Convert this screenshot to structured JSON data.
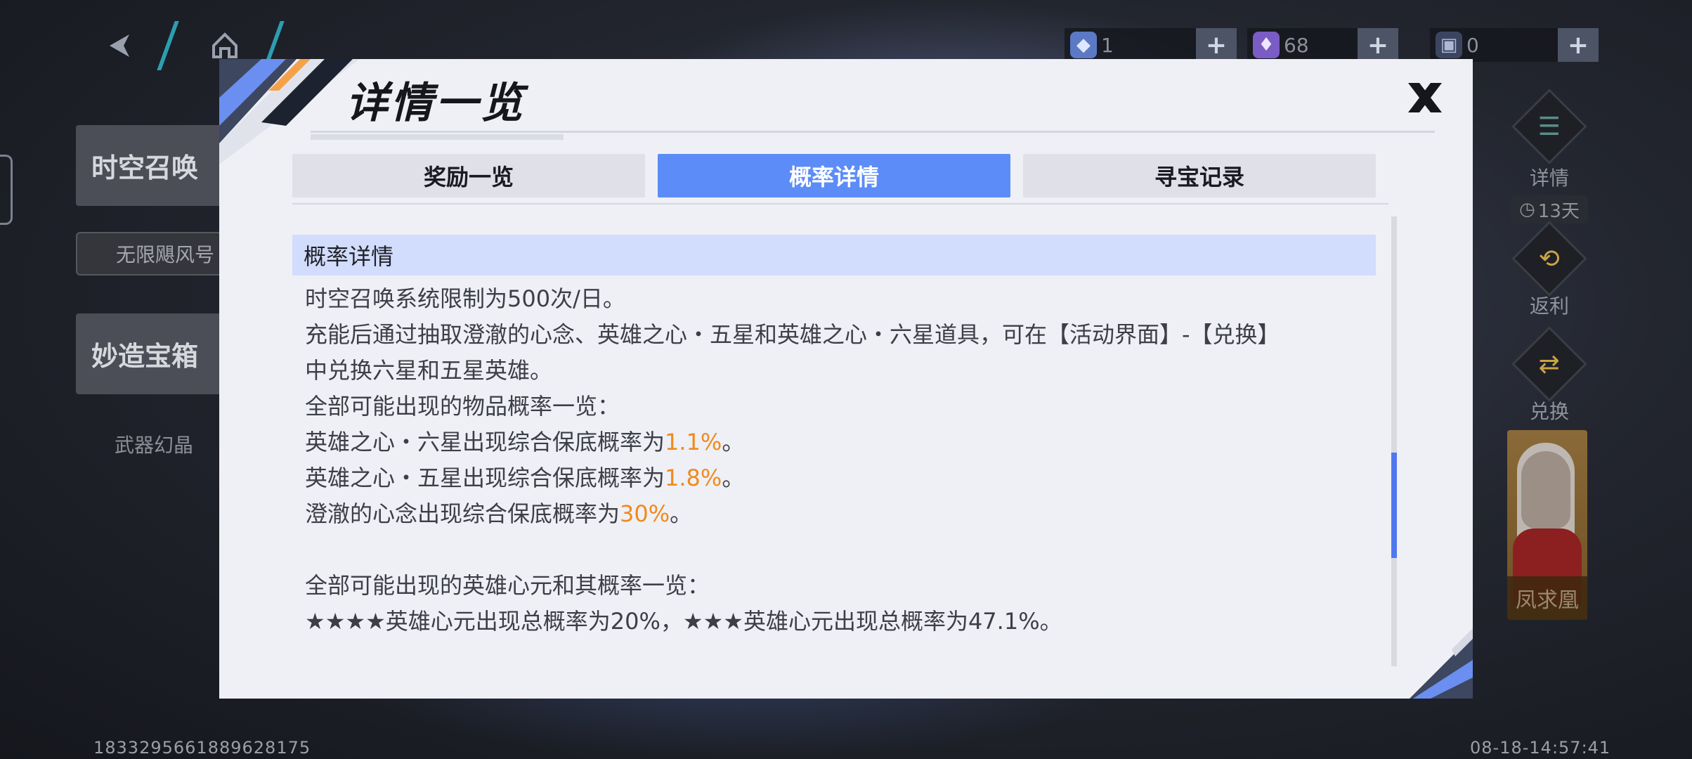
{
  "background": {
    "side_menu": {
      "item1": "时空召唤",
      "item1_sub": "无限飓风号",
      "item2": "妙造宝箱",
      "item2_sub": "武器幻晶"
    },
    "currencies": [
      {
        "icon": "crystal-icon",
        "value": "1"
      },
      {
        "icon": "gem-icon",
        "value": "68"
      },
      {
        "icon": "ticket-icon",
        "value": "0"
      }
    ],
    "right_panel": {
      "details_label": "详情",
      "timer_label": "13天",
      "rebate_label": "返利",
      "exchange_label": "兑换",
      "hero_name": "凤求凰"
    },
    "footer_id": "1833295661889628175",
    "footer_time": "08-18-14:57:41"
  },
  "dialog": {
    "title": "详情一览",
    "close_glyph": "✕",
    "tabs": [
      {
        "label": "奖励一览",
        "active": false
      },
      {
        "label": "概率详情",
        "active": true
      },
      {
        "label": "寻宝记录",
        "active": false
      }
    ],
    "section_title": "概率详情",
    "lines": {
      "l1": "时空召唤系统限制为500次/日。",
      "l2": "充能后通过抽取澄澈的心念、英雄之心・五星和英雄之心・六星道具，可在【活动界面】-【兑换】",
      "l3": "中兑换六星和五星英雄。",
      "l4": "全部可能出现的物品概率一览：",
      "l5_pre": "英雄之心・六星出现综合保底概率为",
      "l5_val": "1.1%",
      "l5_post": "。",
      "l6_pre": "英雄之心・五星出现综合保底概率为",
      "l6_val": "1.8%",
      "l6_post": "。",
      "l7_pre": "澄澈的心念出现综合保底概率为",
      "l7_val": "30%",
      "l7_post": "。",
      "l8": "全部可能出现的英雄心元和其概率一览：",
      "l9": "★★★★英雄心元出现总概率为20%，★★★英雄心元出现总概率为47.1%。"
    }
  },
  "colors": {
    "accent_blue": "#5c8cf7",
    "highlight_orange": "#f08a1c",
    "section_bg": "#d2dcfd",
    "dialog_bg": "#eff0f6"
  }
}
